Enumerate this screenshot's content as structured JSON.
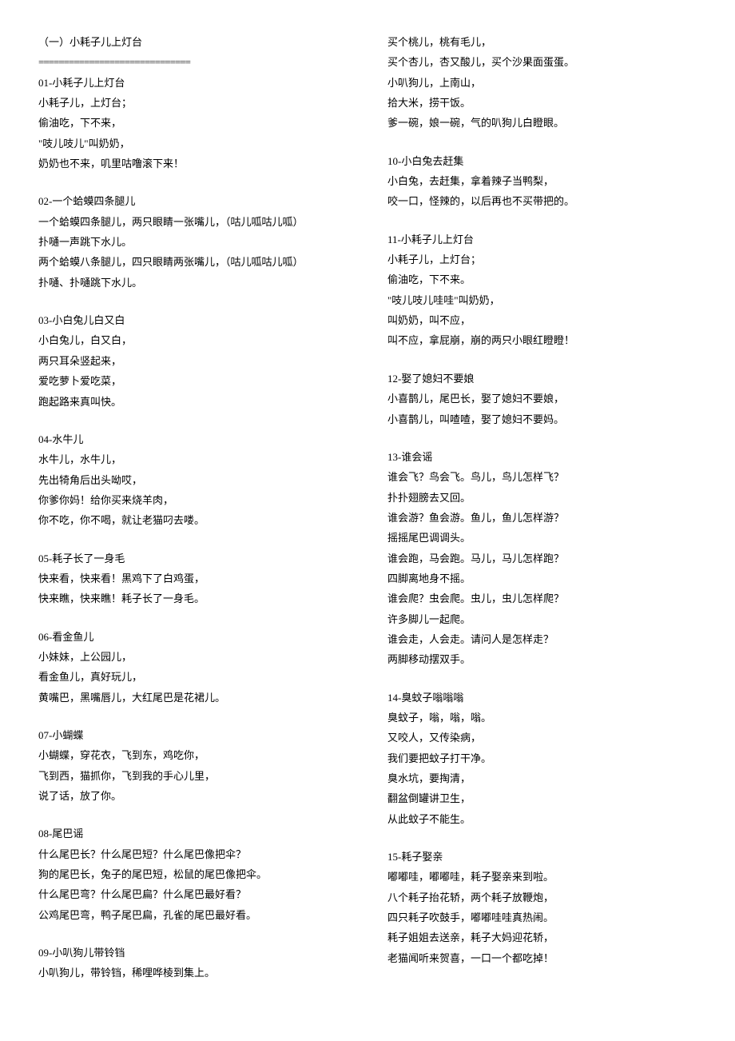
{
  "left": {
    "sectionTitle": "（一）小耗子儿上灯台",
    "divider": "==============================",
    "blocks": [
      {
        "title": "01-小耗子儿上灯台",
        "lines": [
          "小耗子儿，上灯台；",
          "偷油吃，下不来，",
          "\"吱儿吱儿\"叫奶奶，",
          "奶奶也不来，叽里咕噜滚下来！"
        ]
      },
      {
        "title": "02-一个蛤蟆四条腿儿",
        "lines": [
          "一个蛤蟆四条腿儿，两只眼睛一张嘴儿，（咕儿呱咕儿呱）",
          "扑嗵一声跳下水儿。",
          "两个蛤蟆八条腿儿，四只眼睛两张嘴儿，（咕儿呱咕儿呱）",
          "扑嗵、扑嗵跳下水儿。"
        ]
      },
      {
        "title": "03-小白兔儿白又白",
        "lines": [
          "小白兔儿，白又白，",
          "两只耳朵竖起来，",
          "爱吃萝卜爱吃菜，",
          "跑起路来真叫快。"
        ]
      },
      {
        "title": "04-水牛儿",
        "lines": [
          "水牛儿，水牛儿，",
          "先出犄角后出头呦哎，",
          "你爹你妈！给你买来烧羊肉，",
          "你不吃，你不喝，就让老猫叼去喽。"
        ]
      },
      {
        "title": "05-耗子长了一身毛",
        "lines": [
          "快来看，快来看！黑鸡下了白鸡蛋，",
          "快来瞧，快来瞧！耗子长了一身毛。"
        ]
      },
      {
        "title": "06-看金鱼儿",
        "lines": [
          "小妹妹，上公园儿，",
          "看金鱼儿，真好玩儿，",
          "黄嘴巴，黑嘴唇儿，大红尾巴是花裙儿。"
        ]
      },
      {
        "title": "07-小蝴蝶",
        "lines": [
          "小蝴蝶，穿花衣，飞到东，鸡吃你，",
          "飞到西，猫抓你，飞到我的手心儿里，",
          "说了话，放了你。"
        ]
      },
      {
        "title": "08-尾巴谣",
        "lines": [
          "什么尾巴长？什么尾巴短？什么尾巴像把伞？",
          "狗的尾巴长，兔子的尾巴短，松鼠的尾巴像把伞。",
          "什么尾巴弯？什么尾巴扁？什么尾巴最好看？",
          "公鸡尾巴弯，鸭子尾巴扁，孔雀的尾巴最好看。"
        ]
      },
      {
        "title": "09-小叭狗儿带铃铛",
        "lines": [
          "小叭狗儿，带铃铛，稀哩哗棱到集上。"
        ]
      }
    ]
  },
  "right": {
    "leadLines": [
      "买个桃儿，桃有毛儿，",
      "买个杏儿，杏又酸儿，买个沙果面蛋蛋。",
      "小叭狗儿，上南山，",
      "拾大米，捞干饭。",
      "爹一碗，娘一碗，气的叭狗儿白瞪眼。"
    ],
    "blocks": [
      {
        "title": "10-小白兔去赶集",
        "lines": [
          "小白兔，去赶集，拿着辣子当鸭梨，",
          "咬一口，怪辣的，以后再也不买带把的。"
        ]
      },
      {
        "title": "11-小耗子儿上灯台",
        "lines": [
          "小耗子儿，上灯台；",
          "偷油吃，下不来。",
          "\"吱儿吱儿哇哇\"叫奶奶，",
          "叫奶奶，叫不应，",
          "叫不应，拿屁崩，崩的两只小眼红瞪瞪！"
        ]
      },
      {
        "title": "12-娶了媳妇不要娘",
        "lines": [
          "小喜鹊儿，尾巴长，娶了媳妇不要娘，",
          "小喜鹊儿，叫喳喳，娶了媳妇不要妈。"
        ]
      },
      {
        "title": "13-谁会谣",
        "lines": [
          "谁会飞？鸟会飞。鸟儿，鸟儿怎样飞？",
          "扑扑翅膀去又回。",
          "谁会游？鱼会游。鱼儿，鱼儿怎样游？",
          "摇摇尾巴调调头。",
          "谁会跑，马会跑。马儿，马儿怎样跑？",
          "四脚离地身不摇。",
          "谁会爬？虫会爬。虫儿，虫儿怎样爬？",
          "许多脚儿一起爬。",
          "谁会走，人会走。请问人是怎样走？",
          "两脚移动摆双手。"
        ]
      },
      {
        "title": "14-臭蚊子嗡嗡嗡",
        "lines": [
          "臭蚊子，嗡，嗡，嗡。",
          "又咬人，又传染病，",
          "我们要把蚊子打干净。",
          "臭水坑，要掏清，",
          "翻盆倒罐讲卫生，",
          "从此蚊子不能生。"
        ]
      },
      {
        "title": "15-耗子娶亲",
        "lines": [
          "嘟嘟哇，嘟嘟哇，耗子娶亲来到啦。",
          "八个耗子抬花轿，两个耗子放鞭炮，",
          "四只耗子吹鼓手，嘟嘟哇哇真热闹。",
          "耗子姐姐去送亲，耗子大妈迎花轿，",
          "老猫闻听来贺喜，一口一个都吃掉！"
        ]
      }
    ]
  }
}
